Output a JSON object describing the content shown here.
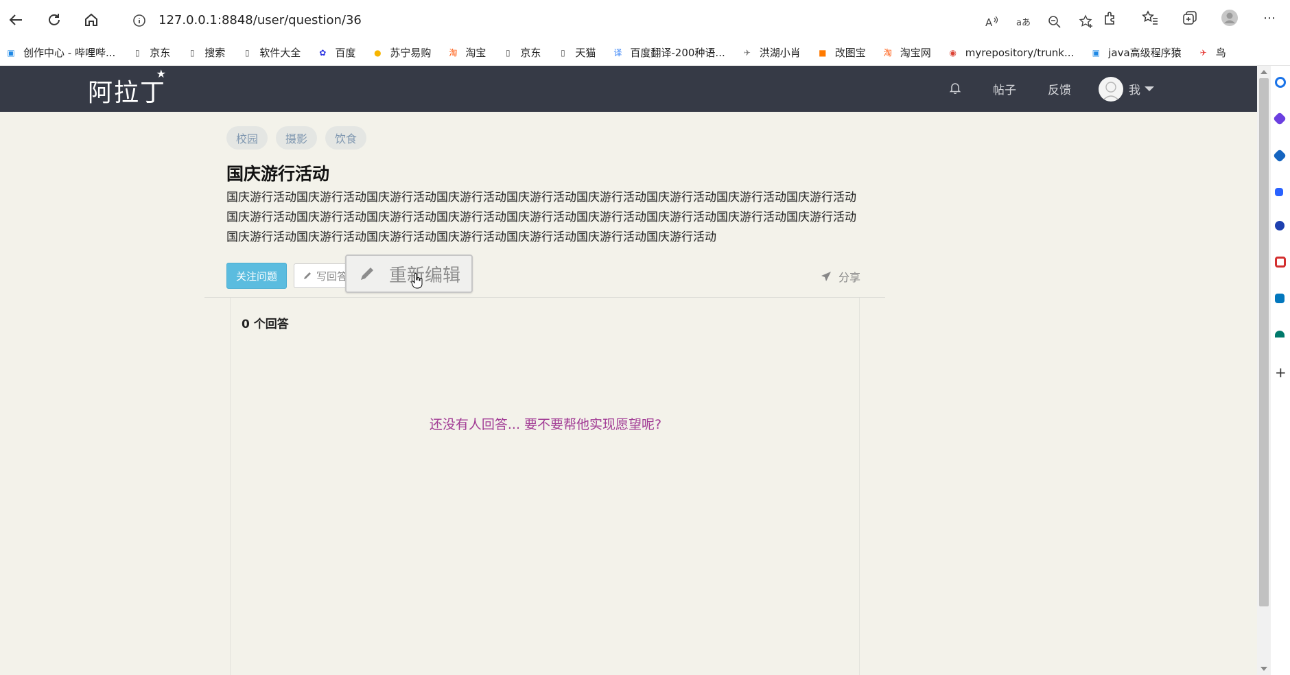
{
  "browser": {
    "url_host": "127.0.0.1",
    "url_rest": ":8848/user/question/36",
    "colors": {
      "chrome_bg": "#ffffff",
      "text": "#222222"
    }
  },
  "bookmarks": [
    {
      "label": "创作中心 - 哔哩哔...",
      "icon": "bilibili-icon",
      "color": "#1e88e5"
    },
    {
      "label": "京东",
      "icon": "page-icon",
      "color": "#555555"
    },
    {
      "label": "搜索",
      "icon": "page-icon",
      "color": "#555555"
    },
    {
      "label": "软件大全",
      "icon": "page-icon",
      "color": "#555555"
    },
    {
      "label": "百度",
      "icon": "baidu-paw-icon",
      "color": "#2932e1"
    },
    {
      "label": "苏宁易购",
      "icon": "suning-icon",
      "color": "#f7b500"
    },
    {
      "label": "淘宝",
      "icon": "taobao-icon",
      "color": "#ff5000"
    },
    {
      "label": "京东",
      "icon": "page-icon",
      "color": "#555555"
    },
    {
      "label": "天猫",
      "icon": "page-icon",
      "color": "#555555"
    },
    {
      "label": "百度翻译-200种语...",
      "icon": "translate-icon",
      "color": "#2e7df6"
    },
    {
      "label": "洪湖小肖",
      "icon": "bird-icon",
      "color": "#777777"
    },
    {
      "label": "改图宝",
      "icon": "gaitubao-icon",
      "color": "#ff7a00"
    },
    {
      "label": "淘宝网",
      "icon": "taobao-icon",
      "color": "#ff5000"
    },
    {
      "label": "myrepository/trunk...",
      "icon": "chrome-icon",
      "color": "#db4437"
    },
    {
      "label": "java高级程序猿",
      "icon": "bilibili-icon",
      "color": "#1e88e5"
    },
    {
      "label": "鸟",
      "icon": "bird-red-icon",
      "color": "#e53935"
    }
  ],
  "navbar": {
    "brand": "阿拉丁",
    "links": {
      "posts": "帖子",
      "feedback": "反馈",
      "me": "我"
    },
    "colors": {
      "bg": "#363a46"
    }
  },
  "question": {
    "tags": [
      "校园",
      "摄影",
      "饮食"
    ],
    "title": "国庆游行活动",
    "body": "国庆游行活动国庆游行活动国庆游行活动国庆游行活动国庆游行活动国庆游行活动国庆游行活动国庆游行活动国庆游行活动国庆游行活动国庆游行活动国庆游行活动国庆游行活动国庆游行活动国庆游行活动国庆游行活动国庆游行活动国庆游行活动国庆游行活动国庆游行活动国庆游行活动国庆游行活动国庆游行活动国庆游行活动国庆游行活动",
    "follow_label": "关注问题",
    "answer_label": "写回答",
    "reedit_label": "重新编辑",
    "share_label": "分享"
  },
  "answers": {
    "count_label": "0 个回答",
    "empty_message": "还没有人回答... 要不要帮他实现愿望呢?",
    "colors": {
      "empty_message": "#a23c95"
    }
  }
}
